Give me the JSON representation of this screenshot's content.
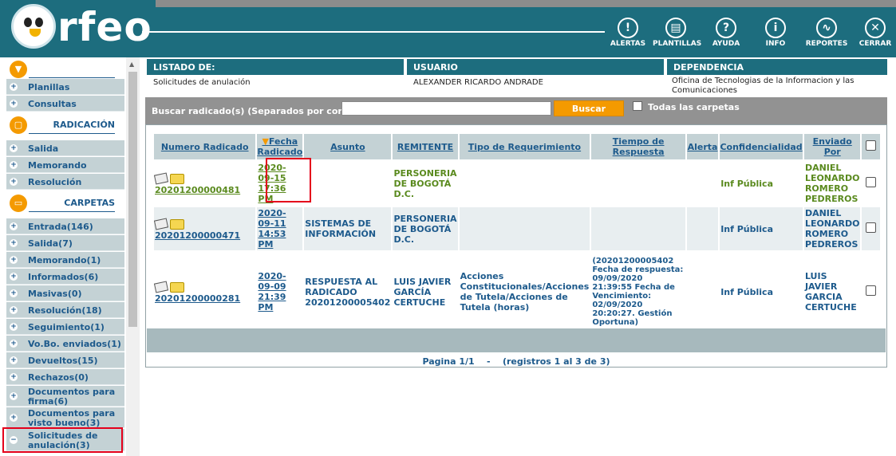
{
  "app": {
    "logo_text": "rfeo"
  },
  "header": {
    "buttons": [
      {
        "label": "ALERTAS",
        "icon": "alert-icon",
        "glyph": "!"
      },
      {
        "label": "PLANTILLAS",
        "icon": "document-icon",
        "glyph": "▤"
      },
      {
        "label": "AYUDA",
        "icon": "help-icon",
        "glyph": "?"
      },
      {
        "label": "INFO",
        "icon": "info-icon",
        "glyph": "i"
      },
      {
        "label": "REPORTES",
        "icon": "reports-icon",
        "glyph": "∿"
      },
      {
        "label": "CERRAR",
        "icon": "close-icon",
        "glyph": "✕"
      }
    ]
  },
  "sidebar": {
    "top_items": [
      {
        "label": "Planillas"
      },
      {
        "label": "Consultas"
      }
    ],
    "radicacion": {
      "title": "RADICACIÓN",
      "items": [
        {
          "label": "Salida"
        },
        {
          "label": "Memorando"
        },
        {
          "label": "Resolución"
        }
      ]
    },
    "carpetas": {
      "title": "CARPETAS",
      "items": [
        {
          "label": "Entrada(146)"
        },
        {
          "label": "Salida(7)"
        },
        {
          "label": "Memorando(1)"
        },
        {
          "label": "Informados(6)"
        },
        {
          "label": "Masivas(0)"
        },
        {
          "label": "Resolución(18)"
        },
        {
          "label": "Seguimiento(1)"
        },
        {
          "label": "Vo.Bo. enviados(1)"
        },
        {
          "label": "Devueltos(15)"
        },
        {
          "label": "Rechazos(0)"
        },
        {
          "label": "Documentos para firma(6)"
        },
        {
          "label": "Documentos para visto bueno(3)"
        },
        {
          "label": "Solicitudes de anulación(3)"
        }
      ]
    }
  },
  "info_header": {
    "listado_label": "LISTADO DE:",
    "listado_value": "Solicitudes de anulación",
    "usuario_label": "USUARIO",
    "usuario_value": "ALEXANDER RICARDO ANDRADE",
    "dependencia_label": "DEPENDENCIA",
    "dependencia_value": "Oficina de Tecnologias de la Informacion y las Comunicaciones"
  },
  "search": {
    "label": "Buscar radicado(s) (Separados por coma)",
    "value": "",
    "button": "Buscar",
    "all_folders_label": "Todas las carpetas"
  },
  "table": {
    "columns": [
      "Numero Radicado",
      "Fecha Radicado",
      "Asunto",
      "REMITENTE",
      "Tipo de Requerimiento",
      "Tiempo de Respuesta",
      "Alerta",
      "Confidencialidad",
      "Enviado Por"
    ],
    "rows": [
      {
        "numero": "20201200000481",
        "fecha": "2020-09-15 17:36 PM",
        "asunto": "",
        "remitente": "PERSONERIA DE BOGOTÁ D.C.",
        "tipo": "",
        "tiempo": "",
        "alerta": "",
        "confidencialidad": "Inf Pública",
        "enviado": "DANIEL LEONARDO ROMERO PEDREROS"
      },
      {
        "numero": "20201200000471",
        "fecha": "2020-09-11 14:53 PM",
        "asunto": "SISTEMAS DE INFORMACIÓN",
        "remitente": "PERSONERIA DE BOGOTÁ D.C.",
        "tipo": "",
        "tiempo": "",
        "alerta": "",
        "confidencialidad": "Inf Pública",
        "enviado": "DANIEL LEONARDO ROMERO PEDREROS"
      },
      {
        "numero": "20201200000281",
        "fecha": "2020-09-09 21:39 PM",
        "asunto": "RESPUESTA AL RADICADO 20201200005402",
        "remitente": "LUIS JAVIER GARCÍA CERTUCHE",
        "tipo": "Acciones Constitucionales/Acciones de Tutela/Acciones de Tutela (horas)",
        "tiempo": "(20201200005402 Fecha de respuesta: 09/09/2020 21:39:55 Fecha de Vencimiento: 02/09/2020 20:20:27. Gestión Oportuna)",
        "alerta": "",
        "confidencialidad": "Inf Pública",
        "enviado": "LUIS JAVIER GARCIA CERTUCHE"
      }
    ]
  },
  "pager": {
    "page": "Pagina 1/1",
    "sep": "-",
    "records": "(registros 1 al 3 de 3)"
  },
  "colors": {
    "header_bg": "#1d6d7e",
    "accent_orange": "#f49a00",
    "highlight_red": "#e4001b"
  }
}
